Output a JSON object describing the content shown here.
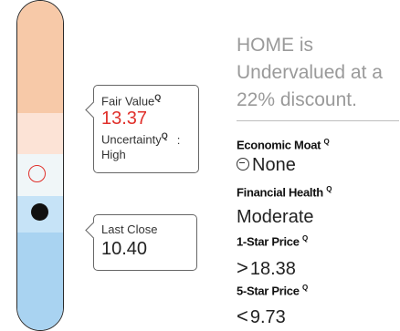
{
  "valuation": {
    "fair_value_label": "Fair Value",
    "fair_value": "13.37",
    "uncertainty_label": "Uncertainty",
    "uncertainty_sep": ":",
    "uncertainty_value": "High",
    "last_close_label": "Last Close",
    "last_close": "10.40",
    "q_mark": "Q"
  },
  "summary": {
    "headline": "HOME is Undervalued at a 22% discount."
  },
  "metrics": {
    "moat_label": "Economic Moat",
    "moat_value": "None",
    "health_label": "Financial Health",
    "health_value": "Moderate",
    "one_star_label": "1-Star Price",
    "one_star_symbol": ">",
    "one_star_value": "18.38",
    "five_star_label": "5-Star Price",
    "five_star_symbol": "<",
    "five_star_value": "9.73"
  },
  "colors": {
    "fair_value": "#e0302b",
    "overvalued_band": "#f7c9a8",
    "undervalued_band": "#a9d3f1"
  }
}
